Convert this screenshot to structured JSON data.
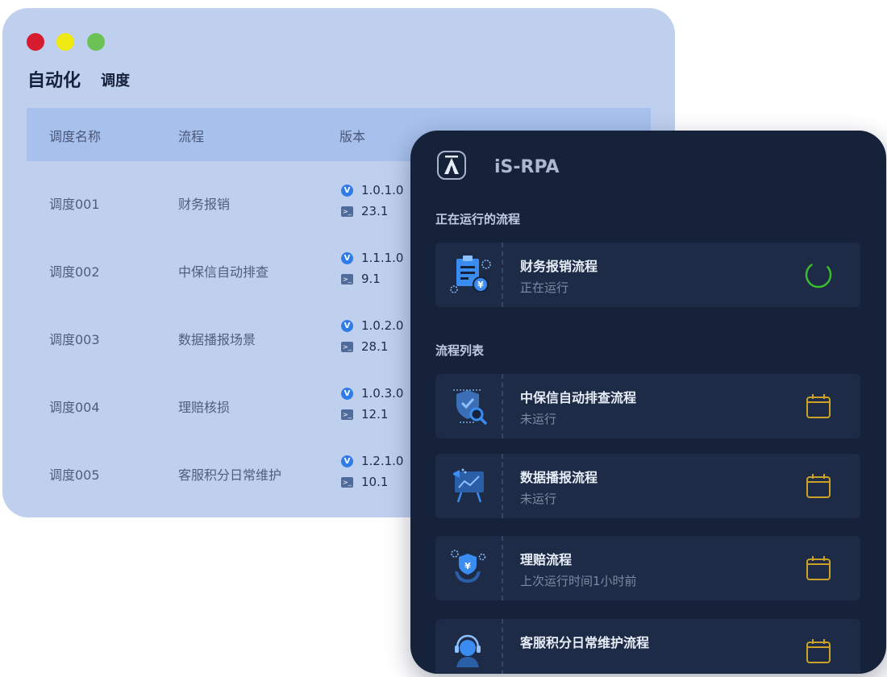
{
  "window": {
    "title": "自动化",
    "subtitle": "调度",
    "columns": [
      "调度名称",
      "流程",
      "版本"
    ],
    "rows": [
      {
        "name": "调度001",
        "flow": "财务报销",
        "version": "1.0.1.0",
        "build": "23.1"
      },
      {
        "name": "调度002",
        "flow": "中保信自动排查",
        "version": "1.1.1.0",
        "build": "9.1"
      },
      {
        "name": "调度003",
        "flow": "数据播报场景",
        "version": "1.0.2.0",
        "build": "28.1"
      },
      {
        "name": "调度004",
        "flow": "理赔核损",
        "version": "1.0.3.0",
        "build": "12.1"
      },
      {
        "name": "调度005",
        "flow": "客服积分日常维护",
        "version": "1.2.1.0",
        "build": "10.1"
      }
    ]
  },
  "panel": {
    "brand": "iS-RPA",
    "running_title": "正在运行的流程",
    "running": {
      "title": "财务报销流程",
      "status": "正在运行",
      "icon": "finance-document-icon",
      "action_icon": "loading-spinner-icon"
    },
    "list_title": "流程列表",
    "list": [
      {
        "title": "中保信自动排查流程",
        "status": "未运行",
        "icon": "shield-search-icon",
        "action_icon": "calendar-icon"
      },
      {
        "title": "数据播报流程",
        "status": "未运行",
        "icon": "data-broadcast-icon",
        "action_icon": "calendar-icon"
      },
      {
        "title": "理赔流程",
        "status": "上次运行时间1小时前",
        "icon": "claims-hands-icon",
        "action_icon": "calendar-icon"
      },
      {
        "title": "客服积分日常维护流程",
        "status": "",
        "icon": "customer-service-icon",
        "action_icon": "calendar-icon"
      }
    ]
  },
  "colors": {
    "window_bg": "#bfd0ee",
    "table_header": "#a7c0ec",
    "panel_bg": "#15223a",
    "card_bg": "#1d2b46",
    "accent_green": "#3cbb2e",
    "calendar_gold": "#c9a227",
    "icon_blue": "#3a8cf0"
  }
}
